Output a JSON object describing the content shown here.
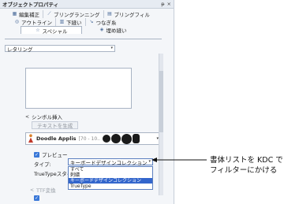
{
  "window": {
    "title": "オブジェクトプロパティ",
    "pin": "ᵽ",
    "close": "×"
  },
  "tabs": {
    "row1": [
      {
        "label": "編集補正",
        "icon": "edit-correction-icon",
        "glyph": "▦"
      },
      {
        "label": "ブリングランニング",
        "icon": "running-icon",
        "glyph": "⟋"
      },
      {
        "label": "ブリングフィル",
        "icon": "fill-icon",
        "glyph": "▤"
      }
    ],
    "row2": [
      {
        "label": "アウトライン",
        "icon": "outline-icon",
        "glyph": "◎"
      },
      {
        "label": "下縫い",
        "icon": "underlay-icon",
        "glyph": "▥"
      },
      {
        "label": "つなぎ糸",
        "icon": "connector-icon",
        "glyph": "↘"
      }
    ],
    "row3": [
      {
        "label": "スペシャル",
        "icon": "special-star-icon",
        "glyph": "☆",
        "active": true
      },
      {
        "label": "埋め縫い",
        "icon": "fill-stitch-icon",
        "glyph": "◈"
      }
    ]
  },
  "main": {
    "type_select": {
      "value": "レタリング"
    },
    "symbol_insert_label": "シンボル挿入",
    "text_generate_label": "テキストを生成",
    "font": {
      "name": "Doodle Applis",
      "sizes": "[70 - 10..",
      "sample_text": "●●●]"
    },
    "preview_label": "プレビュー",
    "type_label": "タイプ:",
    "type_value": "キーボードデザインコレクション",
    "truetype_style_label": "TrueTypeスタイル:",
    "dim_label": "TTF変換",
    "dropdown_options": [
      "すべて",
      "刺繍",
      "キーボードデザインコレクション",
      "TrueType"
    ]
  },
  "callout": {
    "line1": "書体リストを KDC で",
    "line2": "フィルターにかける"
  }
}
